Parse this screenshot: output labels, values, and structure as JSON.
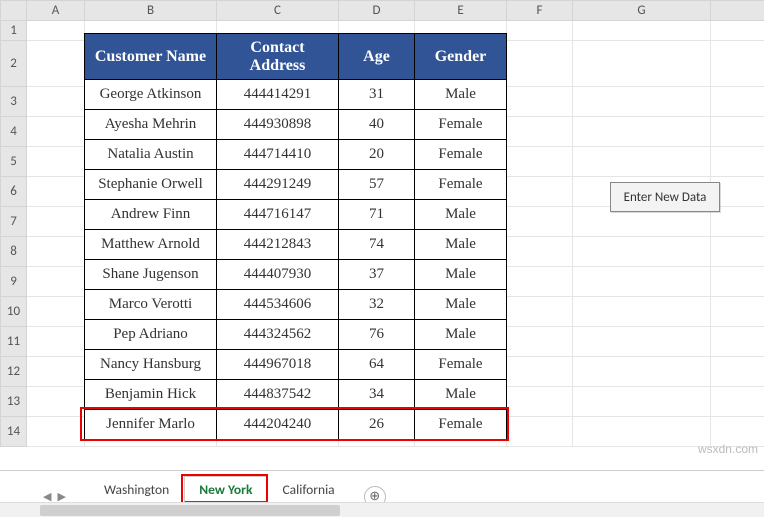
{
  "columns": [
    "A",
    "B",
    "C",
    "D",
    "E",
    "F",
    "G"
  ],
  "row_numbers": [
    1,
    2,
    3,
    4,
    5,
    6,
    7,
    8,
    9,
    10,
    11,
    12,
    13,
    14
  ],
  "table": {
    "headers": [
      "Customer Name",
      "Contact Address",
      "Age",
      "Gender"
    ],
    "rows": [
      {
        "name": "George Atkinson",
        "contact": "444414291",
        "age": "31",
        "gender": "Male"
      },
      {
        "name": "Ayesha Mehrin",
        "contact": "444930898",
        "age": "40",
        "gender": "Female"
      },
      {
        "name": "Natalia Austin",
        "contact": "444714410",
        "age": "20",
        "gender": "Female"
      },
      {
        "name": "Stephanie Orwell",
        "contact": "444291249",
        "age": "57",
        "gender": "Female"
      },
      {
        "name": "Andrew Finn",
        "contact": "444716147",
        "age": "71",
        "gender": "Male"
      },
      {
        "name": "Matthew Arnold",
        "contact": "444212843",
        "age": "74",
        "gender": "Male"
      },
      {
        "name": "Shane Jugenson",
        "contact": "444407930",
        "age": "37",
        "gender": "Male"
      },
      {
        "name": "Marco Verotti",
        "contact": "444534606",
        "age": "32",
        "gender": "Male"
      },
      {
        "name": "Pep Adriano",
        "contact": "444324562",
        "age": "76",
        "gender": "Male"
      },
      {
        "name": "Nancy Hansburg",
        "contact": "444967018",
        "age": "64",
        "gender": "Female"
      },
      {
        "name": "Benjamin Hick",
        "contact": "444837542",
        "age": "34",
        "gender": "Male"
      },
      {
        "name": "Jennifer Marlo",
        "contact": "444204240",
        "age": "26",
        "gender": "Female"
      }
    ]
  },
  "button_label": "Enter New Data",
  "tabs": [
    "Washington",
    "New York",
    "California"
  ],
  "active_tab": "New York",
  "watermark": "wsxdn.com",
  "addtab_glyph": "⊕",
  "nav_glyphs": [
    "◀",
    "▶"
  ],
  "chart_data": {
    "type": "table",
    "title": "",
    "columns": [
      "Customer Name",
      "Contact Address",
      "Age",
      "Gender"
    ],
    "rows": [
      [
        "George Atkinson",
        "444414291",
        31,
        "Male"
      ],
      [
        "Ayesha Mehrin",
        "444930898",
        40,
        "Female"
      ],
      [
        "Natalia Austin",
        "444714410",
        20,
        "Female"
      ],
      [
        "Stephanie Orwell",
        "444291249",
        57,
        "Female"
      ],
      [
        "Andrew Finn",
        "444716147",
        71,
        "Male"
      ],
      [
        "Matthew Arnold",
        "444212843",
        74,
        "Male"
      ],
      [
        "Shane Jugenson",
        "444407930",
        37,
        "Male"
      ],
      [
        "Marco Verotti",
        "444534606",
        32,
        "Male"
      ],
      [
        "Pep Adriano",
        "444324562",
        76,
        "Male"
      ],
      [
        "Nancy Hansburg",
        "444967018",
        64,
        "Female"
      ],
      [
        "Benjamin Hick",
        "444837542",
        34,
        "Male"
      ],
      [
        "Jennifer Marlo",
        "444204240",
        26,
        "Female"
      ]
    ]
  }
}
